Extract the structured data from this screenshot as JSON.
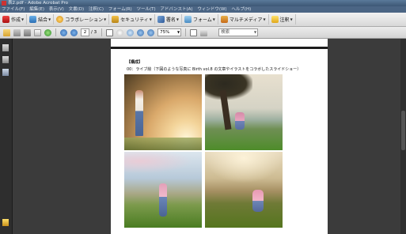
{
  "window": {
    "title": "表2.pdf - Adobe Acrobat Pro"
  },
  "menu": [
    "ファイル(F)",
    "編集(E)",
    "表示(V)",
    "文書(D)",
    "注釈(C)",
    "フォーム(R)",
    "ツール(T)",
    "アドバンスト(A)",
    "ウィンドウ(W)",
    "ヘルプ(H)"
  ],
  "toolbar": {
    "create": "作成",
    "combine": "結合",
    "collab": "コラボレーション",
    "security": "セキュリティ",
    "sign": "署名",
    "forms": "フォーム",
    "multimedia": "マルチメディア",
    "comment": "注釈"
  },
  "nav": {
    "page_current": "2",
    "page_total": "/ 3",
    "zoom": "75%",
    "search_placeholder": "検索"
  },
  "document": {
    "heading": "【構成】",
    "caption": "00：ライブ絵（下図のような写真に Birth vol.8 の文章やイラストをコラボしたスライドショー）"
  },
  "colors": {
    "titlebar": "#3d5775",
    "workspace": "#3b3b3b",
    "page": "#ffffff"
  }
}
